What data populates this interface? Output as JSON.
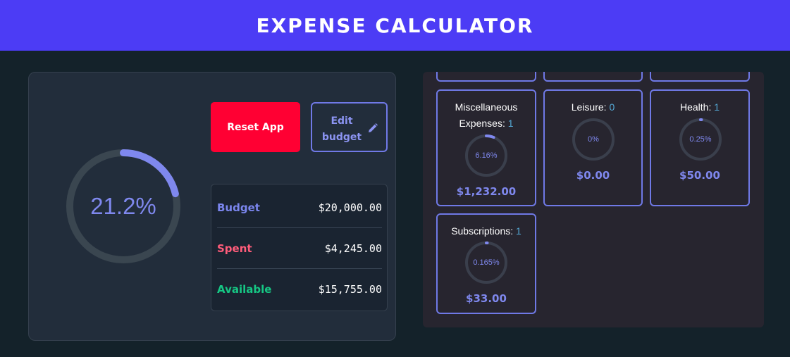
{
  "header": {
    "title": "EXPENSE CALCULATOR"
  },
  "summary": {
    "spent_percent": 21.2,
    "spent_percent_label": "21.2%",
    "reset_label": "Reset App",
    "edit_label_line1": "Edit",
    "edit_label_line2": "budget",
    "edit_icon": "pencil-icon",
    "stats": [
      {
        "label": "Budget",
        "value": "$20,000.00",
        "color": "#7b86ee"
      },
      {
        "label": "Spent",
        "value": "$4,245.00",
        "color": "#ff5c7a"
      },
      {
        "label": "Available",
        "value": "$15,755.00",
        "color": "#16c784"
      }
    ]
  },
  "categories": [
    {
      "name_line1": "Miscellaneous",
      "name_line2": "Expenses:",
      "count": "1",
      "percent": 6.16,
      "percent_label": "6.16%",
      "amount": "$1,232.00"
    },
    {
      "name_line1": "Leisure:",
      "name_line2": "",
      "count": "0",
      "percent": 0,
      "percent_label": "0%",
      "amount": "$0.00"
    },
    {
      "name_line1": "Health:",
      "name_line2": "",
      "count": "1",
      "percent": 0.25,
      "percent_label": "0.25%",
      "amount": "$50.00"
    },
    {
      "name_line1": "Subscriptions:",
      "name_line2": "",
      "count": "1",
      "percent": 0.165,
      "percent_label": "0.165%",
      "amount": "$33.00"
    }
  ],
  "colors": {
    "header_bg": "#4c3cf5",
    "accent": "#7f88ee",
    "ring_track": "#3a4650",
    "reset_bg": "#ff0033"
  }
}
